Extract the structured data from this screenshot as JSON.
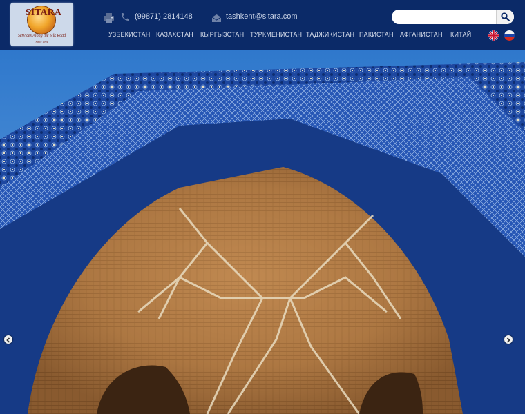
{
  "brand": {
    "name": "SITARA",
    "slogan": "Services Along the Silk Road",
    "since": "Since 1994"
  },
  "contact": {
    "phone": "(99871) 2814148",
    "email": "tashkent@sitara.com",
    "icons": [
      "printer-icon",
      "phone-icon",
      "envelope-icon"
    ]
  },
  "search": {
    "placeholder": "",
    "value": "",
    "icon": "magnifier-icon"
  },
  "nav": {
    "items": [
      "УЗБЕКИСТАН",
      "КАЗАХСТАН",
      "КЫРГЫЗСТАН",
      "ТУРКМЕНИСТАН",
      "ТАДЖИКИСТАН",
      "ПАКИСТАН",
      "АФГАНИСТАН",
      "КИТАЙ"
    ]
  },
  "languages": [
    "english-flag-icon",
    "russian-flag-icon"
  ],
  "hero": {
    "slider_controls": [
      "arrow-left-icon",
      "arrow-right-icon"
    ]
  },
  "colors": {
    "header_bg": "#0b2a68",
    "nav_text": "#d4dbea",
    "tile_blue": "#1e4ba6",
    "brick": "#b07a42",
    "sky": "#3f86d3"
  }
}
